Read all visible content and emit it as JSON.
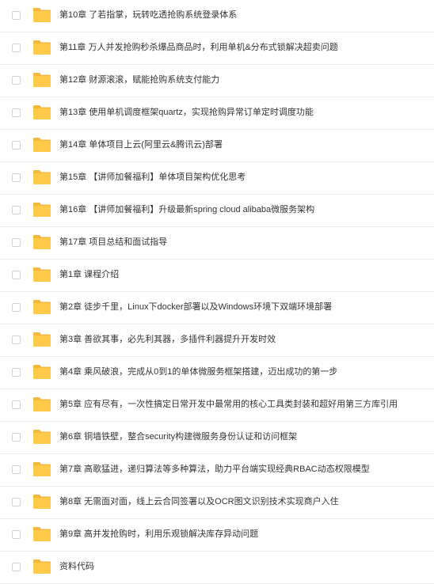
{
  "colors": {
    "folder": "#ffc94a",
    "folder_tab": "#f6b73c",
    "text": "#333333",
    "divider": "#eeeeee",
    "checkbox_border": "#cfd3d8"
  },
  "file_list": {
    "items": [
      {
        "name": "第10章 了若指掌，玩转吃透抢购系统登录体系",
        "icon": "folder-icon"
      },
      {
        "name": "第11章 万人并发抢购秒杀爆品商品时，利用单机&分布式锁解决超卖问题",
        "icon": "folder-icon"
      },
      {
        "name": "第12章 财源滚滚，赋能抢购系统支付能力",
        "icon": "folder-icon"
      },
      {
        "name": "第13章 使用单机调度框架quartz，实现抢购异常订单定时调度功能",
        "icon": "folder-icon"
      },
      {
        "name": "第14章 单体项目上云(阿里云&腾讯云)部署",
        "icon": "folder-icon"
      },
      {
        "name": "第15章 【讲师加餐福利】单体项目架构优化思考",
        "icon": "folder-icon"
      },
      {
        "name": "第16章 【讲师加餐福利】升级最新spring cloud alibaba微服务架构",
        "icon": "folder-icon"
      },
      {
        "name": "第17章 项目总结和面试指导",
        "icon": "folder-icon"
      },
      {
        "name": "第1章 课程介绍",
        "icon": "folder-icon"
      },
      {
        "name": "第2章 徒步千里，Linux下docker部署以及Windows环境下双端环境部署",
        "icon": "folder-icon"
      },
      {
        "name": "第3章 善欲其事，必先利其器，多插件利器提升开发时效",
        "icon": "folder-icon"
      },
      {
        "name": "第4章 乘风破浪，完成从0到1的单体微服务框架搭建，迈出成功的第一步",
        "icon": "folder-icon"
      },
      {
        "name": "第5章 应有尽有，一次性搞定日常开发中最常用的核心工具类封装和超好用第三方库引用",
        "icon": "folder-icon"
      },
      {
        "name": "第6章 铜墙铁壁，整合security构建微服务身份认证和访问框架",
        "icon": "folder-icon"
      },
      {
        "name": "第7章 高歌猛进，递归算法等多种算法，助力平台端实现经典RBAC动态权限模型",
        "icon": "folder-icon"
      },
      {
        "name": "第8章 无需面对面，线上云合同签署以及OCR图文识别技术实现商户入住",
        "icon": "folder-icon"
      },
      {
        "name": "第9章 高并发抢购时，利用乐观锁解决库存异动问题",
        "icon": "folder-icon"
      },
      {
        "name": "资料代码",
        "icon": "folder-icon"
      }
    ]
  }
}
